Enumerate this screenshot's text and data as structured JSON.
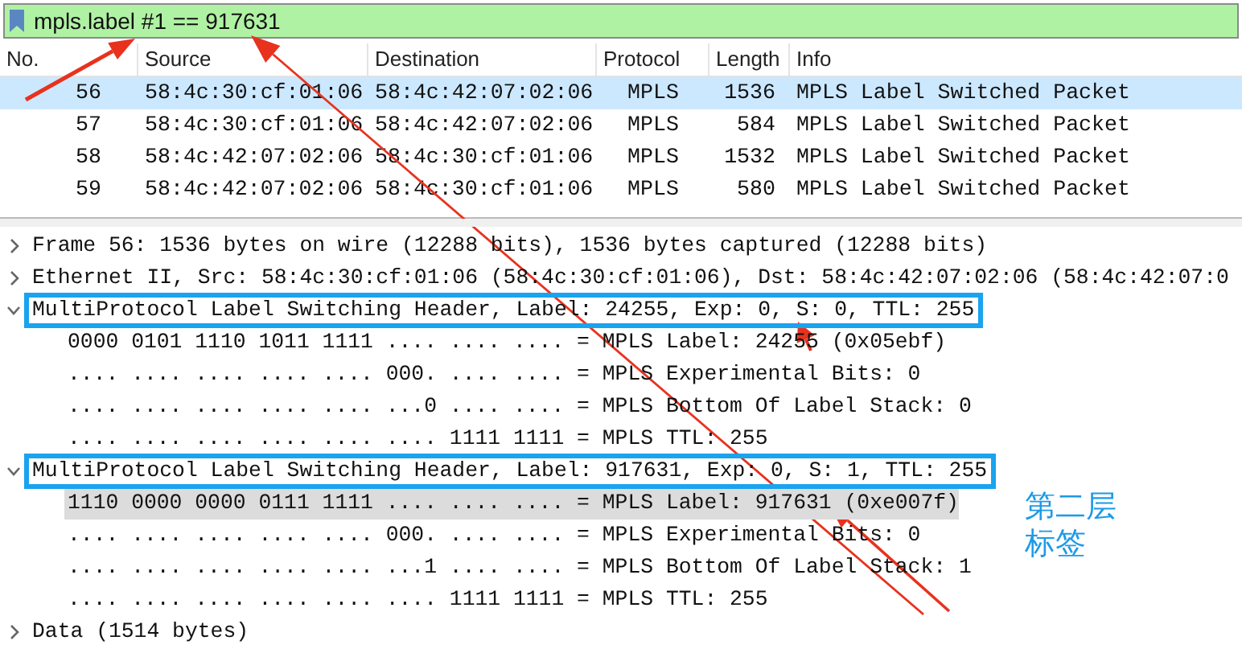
{
  "filter": {
    "text": "mpls.label #1 == 917631"
  },
  "packet_list": {
    "columns": [
      "No.",
      "Source",
      "Destination",
      "Protocol",
      "Length",
      "Info"
    ],
    "rows": [
      {
        "cells": [
          "56",
          "58:4c:30:cf:01:06",
          "58:4c:42:07:02:06",
          "MPLS",
          "1536",
          "MPLS Label Switched Packet"
        ],
        "selected": true
      },
      {
        "cells": [
          "57",
          "58:4c:30:cf:01:06",
          "58:4c:42:07:02:06",
          "MPLS",
          "584",
          "MPLS Label Switched Packet"
        ],
        "selected": false
      },
      {
        "cells": [
          "58",
          "58:4c:42:07:02:06",
          "58:4c:30:cf:01:06",
          "MPLS",
          "1532",
          "MPLS Label Switched Packet"
        ],
        "selected": false
      },
      {
        "cells": [
          "59",
          "58:4c:42:07:02:06",
          "58:4c:30:cf:01:06",
          "MPLS",
          "580",
          "MPLS Label Switched Packet"
        ],
        "selected": false
      }
    ]
  },
  "details": [
    {
      "text": "Frame 56: 1536 bytes on wire (12288 bits), 1536 bytes captured (12288 bits)",
      "expanded": false,
      "selected": false,
      "outlined": false
    },
    {
      "text": "Ethernet II, Src: 58:4c:30:cf:01:06 (58:4c:30:cf:01:06), Dst: 58:4c:42:07:02:06 (58:4c:42:07:0",
      "expanded": false,
      "selected": false,
      "outlined": false
    },
    {
      "text": "MultiProtocol Label Switching Header, Label: 24255, Exp: 0, S: 0, TTL: 255",
      "expanded": true,
      "selected": false,
      "outlined": true,
      "children": [
        {
          "text": "0000 0101 1110 1011 1111 .... .... .... = MPLS Label: 24255 (0x05ebf)",
          "selected": false
        },
        {
          "text": ".... .... .... .... .... 000. .... .... = MPLS Experimental Bits: 0",
          "selected": false
        },
        {
          "text": ".... .... .... .... .... ...0 .... .... = MPLS Bottom Of Label Stack: 0",
          "selected": false
        },
        {
          "text": ".... .... .... .... .... .... 1111 1111 = MPLS TTL: 255",
          "selected": false
        }
      ]
    },
    {
      "text": "MultiProtocol Label Switching Header, Label: 917631, Exp: 0, S: 1, TTL: 255",
      "expanded": true,
      "selected": false,
      "outlined": true,
      "children": [
        {
          "text": "1110 0000 0000 0111 1111 .... .... .... = MPLS Label: 917631 (0xe007f)",
          "selected": true
        },
        {
          "text": ".... .... .... .... .... 000. .... .... = MPLS Experimental Bits: 0",
          "selected": false
        },
        {
          "text": ".... .... .... .... .... ...1 .... .... = MPLS Bottom Of Label Stack: 1",
          "selected": false
        },
        {
          "text": ".... .... .... .... .... .... 1111 1111 = MPLS TTL: 255",
          "selected": false
        }
      ]
    },
    {
      "text": "Data (1514 bytes)",
      "expanded": false,
      "selected": false,
      "outlined": false
    }
  ],
  "annotation": {
    "lines": [
      "第二层",
      "标签"
    ]
  }
}
